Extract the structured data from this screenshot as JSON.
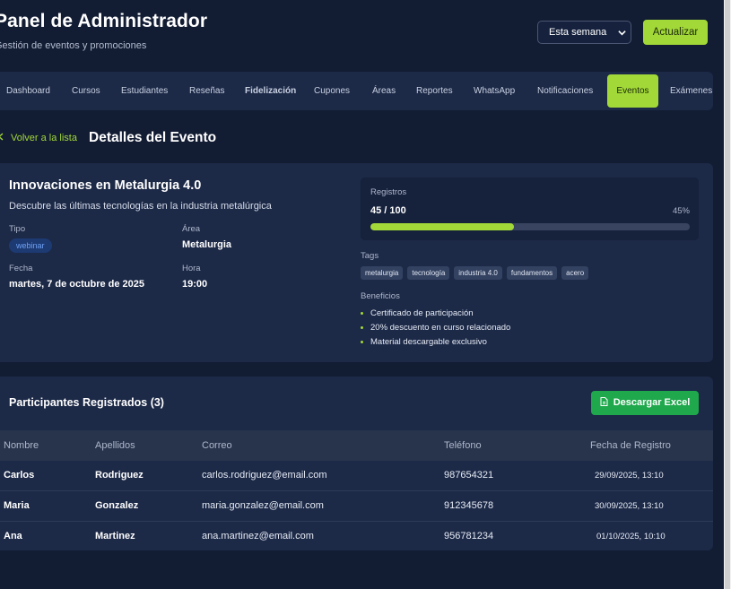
{
  "header": {
    "title": "Panel de Administrador",
    "subtitle": "Gestión de eventos y promociones",
    "period_value": "Esta semana",
    "refresh_label": "Actualizar"
  },
  "nav": {
    "tabs": [
      {
        "label": "Dashboard"
      },
      {
        "label": "Cursos"
      },
      {
        "label": "Estudiantes"
      },
      {
        "label": "Reseñas"
      },
      {
        "label": "Fidelización"
      },
      {
        "label": "Cupones"
      },
      {
        "label": "Áreas"
      },
      {
        "label": "Reportes"
      },
      {
        "label": "WhatsApp"
      },
      {
        "label": "Notificaciones"
      },
      {
        "label": "Eventos"
      },
      {
        "label": "Exámenes"
      }
    ],
    "active": "Eventos"
  },
  "back_label": "Volver a la lista",
  "page_title": "Detalles del Evento",
  "event": {
    "name": "Innovaciones en Metalurgia 4.0",
    "description": "Descubre las últimas tecnologías en la industria metalúrgica",
    "type_label": "Tipo",
    "type_value": "webinar",
    "area_label": "Área",
    "area_value": "Metalurgia",
    "date_label": "Fecha",
    "date_value": "martes, 7 de octubre de 2025",
    "time_label": "Hora",
    "time_value": "19:00",
    "registrations": {
      "label": "Registros",
      "count": "45 / 100",
      "percent": "45%",
      "fraction": 0.45
    },
    "tags_label": "Tags",
    "tags": [
      "metalurgia",
      "tecnología",
      "industria 4.0",
      "fundamentos",
      "acero"
    ],
    "benefits_label": "Beneficios",
    "benefits": [
      "Certificado de participación",
      "20% descuento en curso relacionado",
      "Material descargable exclusivo"
    ]
  },
  "participants": {
    "title": "Participantes Registrados (3)",
    "export_label": "Descargar Excel",
    "columns": [
      "Nombre",
      "Apellidos",
      "Correo",
      "Teléfono",
      "Fecha de Registro"
    ],
    "rows": [
      [
        "Carlos",
        "Rodriguez",
        "carlos.rodriguez@email.com",
        "987654321",
        "29/09/2025, 13:10"
      ],
      [
        "Maria",
        "Gonzalez",
        "maria.gonzalez@email.com",
        "912345678",
        "30/09/2025, 13:10"
      ],
      [
        "Ana",
        "Martinez",
        "ana.martinez@email.com",
        "956781234",
        "01/10/2025, 10:10"
      ]
    ]
  },
  "colors": {
    "accent": "#a2d938",
    "background": "#121c33",
    "card": "#1c2947",
    "excel_button": "#1fa84c",
    "badge": "#1d3a73"
  }
}
